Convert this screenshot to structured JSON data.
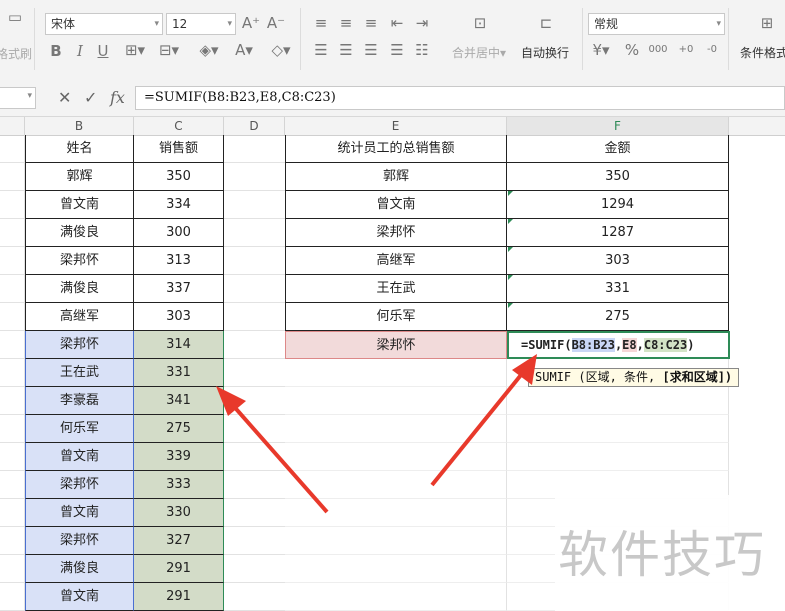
{
  "toolbar": {
    "format_painter_label": "格式刷",
    "font_name": "宋体",
    "font_size": "12",
    "merge_label": "合并居中",
    "wrap_label": "自动换行",
    "number_format": "常规",
    "conditional_label": "条件格式"
  },
  "formula_bar": {
    "formula": "=SUMIF(B8:B23,E8,C8:C23)"
  },
  "columns": [
    "B",
    "C",
    "D",
    "E",
    "F"
  ],
  "left_table": {
    "headers": [
      "姓名",
      "销售额"
    ],
    "rows": [
      [
        "郭辉",
        "350"
      ],
      [
        "曾文南",
        "334"
      ],
      [
        "满俊良",
        "300"
      ],
      [
        "梁邦怀",
        "313"
      ],
      [
        "满俊良",
        "337"
      ],
      [
        "高继军",
        "303"
      ],
      [
        "梁邦怀",
        "314"
      ],
      [
        "王在武",
        "331"
      ],
      [
        "李豪磊",
        "341"
      ],
      [
        "何乐军",
        "275"
      ],
      [
        "曾文南",
        "339"
      ],
      [
        "梁邦怀",
        "333"
      ],
      [
        "曾文南",
        "330"
      ],
      [
        "梁邦怀",
        "327"
      ],
      [
        "满俊良",
        "291"
      ],
      [
        "曾文南",
        "291"
      ]
    ]
  },
  "right_table": {
    "headers": [
      "统计员工的总销售额",
      "金额"
    ],
    "rows": [
      [
        "郭辉",
        "350"
      ],
      [
        "曾文南",
        "1294"
      ],
      [
        "梁邦怀",
        "1287"
      ],
      [
        "高继军",
        "303"
      ],
      [
        "王在武",
        "331"
      ],
      [
        "何乐军",
        "275"
      ]
    ],
    "edit_name": "梁邦怀",
    "edit_formula": {
      "prefix": "=SUMIF(",
      "arg1": "B8:B23",
      "sep1": ",",
      "arg2": "E8",
      "sep2": ",",
      "arg3": "C8:C23",
      "suffix": ")"
    }
  },
  "tooltip": {
    "text": "SUMIF (区域, 条件, ",
    "bold": "[求和区域])"
  },
  "watermark": "软件技巧",
  "colors": {
    "accent_green": "#2e8b57",
    "arrow_red": "#e8392b",
    "range_blue": "#d9e1f7",
    "range_green": "#d3dcc8",
    "range_pink": "#f2dada"
  }
}
